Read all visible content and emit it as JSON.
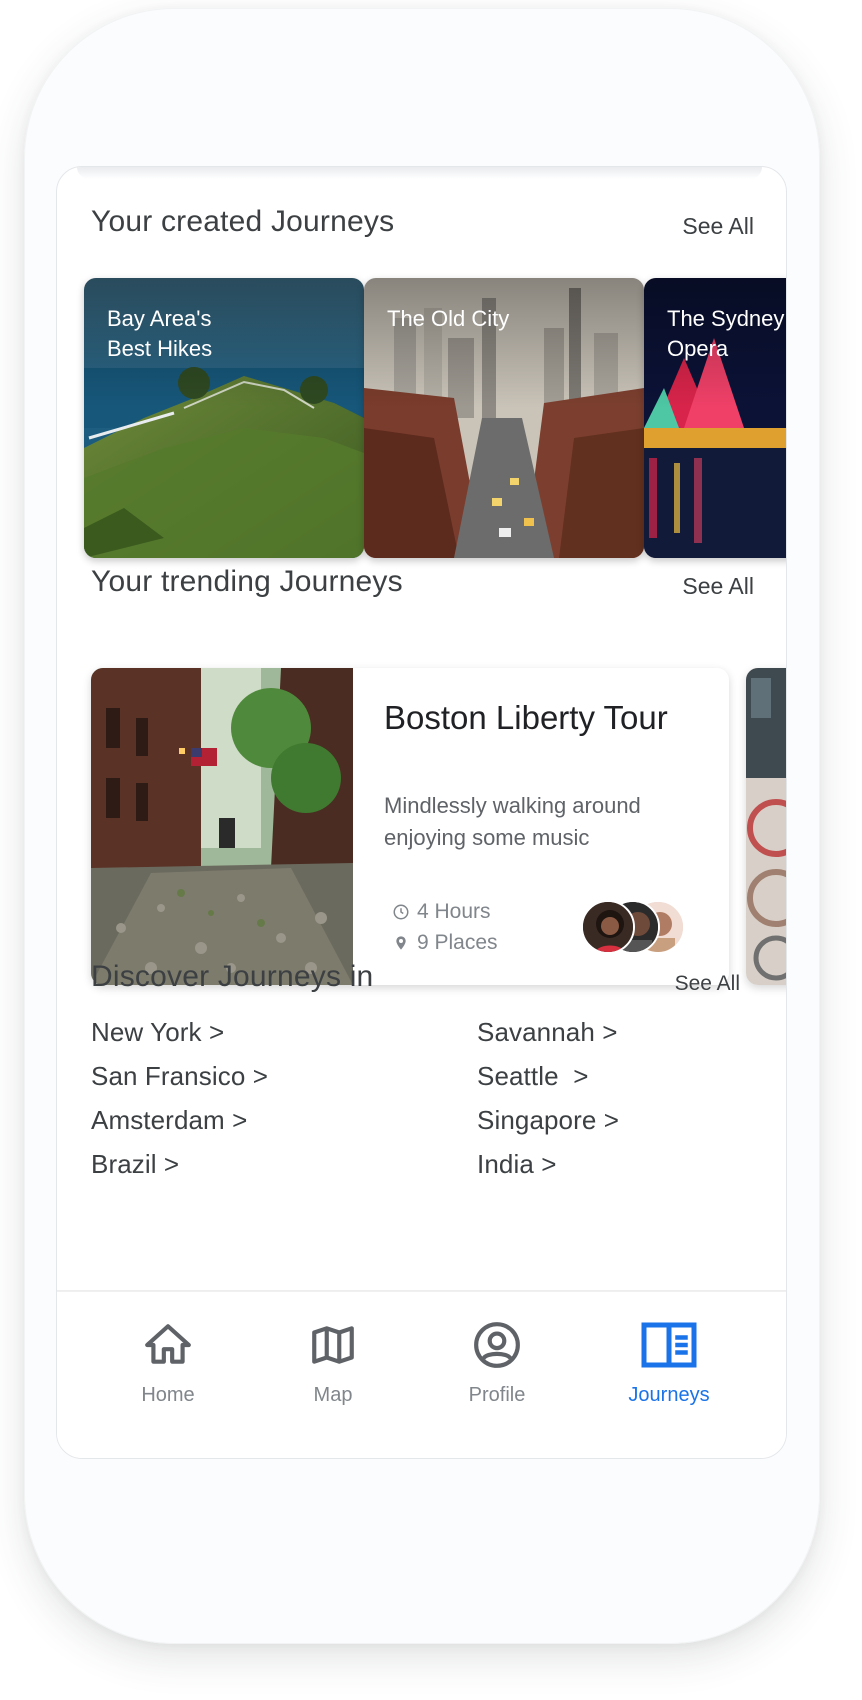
{
  "created": {
    "title": "Your created Journeys",
    "see_all": "See All",
    "cards": [
      {
        "title": "Bay Area's\nBest Hikes"
      },
      {
        "title": "The Old City"
      },
      {
        "title": "The Sydney\nOpera"
      }
    ]
  },
  "trending": {
    "title": "Your trending Journeys",
    "see_all": "See All",
    "card": {
      "title": "Boston Liberty Tour",
      "description": "Mindlessly walking around enjoying some music",
      "duration": "4 Hours",
      "places": "9 Places"
    }
  },
  "discover": {
    "title": "Discover Journeys in",
    "see_all": "See All",
    "cities_left": [
      "New York >",
      "San Fransico >",
      "Amsterdam >",
      "Brazil >"
    ],
    "cities_right": [
      "Savannah >",
      "Seattle  >",
      "Singapore >",
      "India >"
    ]
  },
  "nav": {
    "items": [
      {
        "label": "Home",
        "icon": "home-icon"
      },
      {
        "label": "Map",
        "icon": "map-icon"
      },
      {
        "label": "Profile",
        "icon": "profile-icon"
      },
      {
        "label": "Journeys",
        "icon": "journeys-icon"
      }
    ],
    "active": "Journeys",
    "active_color": "#1a73e8",
    "inactive_color": "#80868b"
  }
}
